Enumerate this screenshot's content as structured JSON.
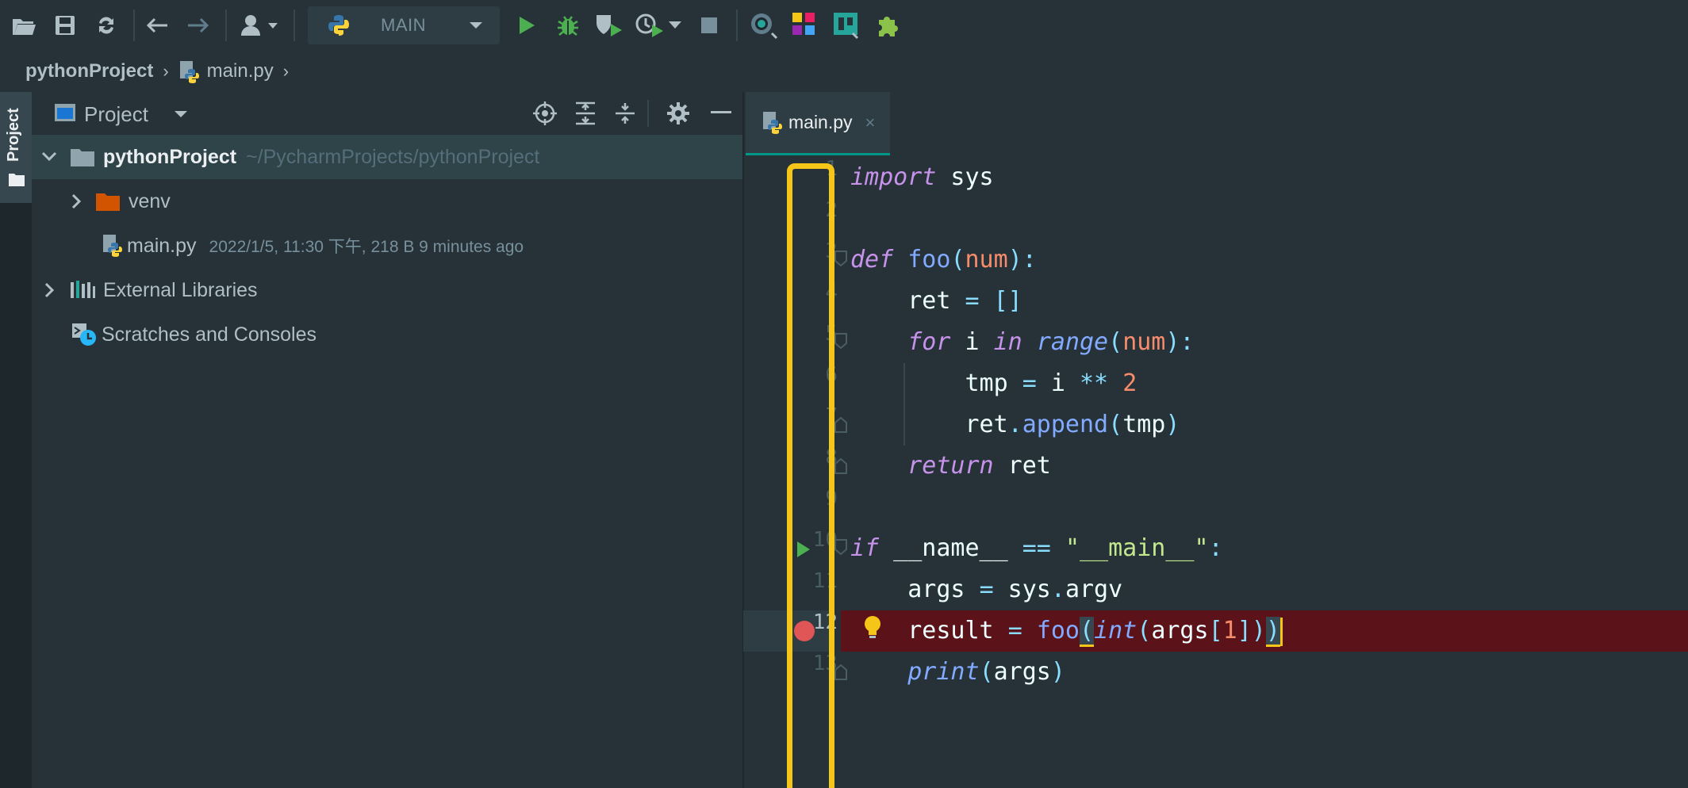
{
  "toolbar": {
    "run_config_label": "MAIN",
    "colors": {
      "run": "#4caf50",
      "debug": "#4caf50",
      "stop": "#78909c"
    }
  },
  "breadcrumb": {
    "project": "pythonProject",
    "file": "main.py"
  },
  "stripe": {
    "label": "Project"
  },
  "project_panel": {
    "title": "Project",
    "tree": [
      {
        "name": "pythonProject",
        "path": "~/PycharmProjects/pythonProject"
      },
      {
        "name": "venv"
      },
      {
        "name": "main.py",
        "meta": "2022/1/5, 11:30 下午, 218 B 9 minutes ago"
      },
      {
        "name": "External Libraries"
      },
      {
        "name": "Scratches and Consoles"
      }
    ]
  },
  "editor": {
    "tab": {
      "label": "main.py",
      "close": "×"
    },
    "line_numbers": [
      "1",
      "2",
      "3",
      "4",
      "5",
      "6",
      "7",
      "8",
      "9",
      "10",
      "11",
      "12",
      "13"
    ],
    "code": {
      "l1_kw": "import",
      "l1_rest": " sys",
      "l3_kw": "def",
      "l3_fn": "foo",
      "l3_p1": "(",
      "l3_param": "num",
      "l3_p2": "):",
      "l4_a": "    ret ",
      "l4_op": "=",
      "l4_b": " ",
      "l4_br": "[]",
      "l5_sp": "    ",
      "l5_kw": "for",
      "l5_a": " i ",
      "l5_kw2": "in",
      "l5_b": " ",
      "l5_fn": "range",
      "l5_p1": "(",
      "l5_param": "num",
      "l5_p2": "):",
      "l6_a": "        tmp ",
      "l6_op": "=",
      "l6_b": " i ",
      "l6_op2": "**",
      "l6_c": " ",
      "l6_num": "2",
      "l7_a": "        ret",
      "l7_dot": ".",
      "l7_fn": "append",
      "l7_p1": "(",
      "l7_b": "tmp",
      "l7_p2": ")",
      "l8_sp": "    ",
      "l8_kw": "return",
      "l8_rest": " ret",
      "l10_kw": "if",
      "l10_a": " __name__ ",
      "l10_op": "==",
      "l10_b": " ",
      "l10_str": "\"__main__\"",
      "l10_c": ":",
      "l11_a": "    args ",
      "l11_op": "=",
      "l11_b": " sys",
      "l11_dot": ".",
      "l11_c": "argv",
      "l12_a": "    result ",
      "l12_op": "=",
      "l12_b": " ",
      "l12_fn": "foo",
      "l12_p1": "(",
      "l12_bi": "int",
      "l12_p2": "(",
      "l12_c": "args",
      "l12_p3": "[",
      "l12_num": "1",
      "l12_p4": "])",
      "l12_p5": ")",
      "l13_sp": "    ",
      "l13_bi": "print",
      "l13_p1": "(",
      "l13_a": "args",
      "l13_p2": ")"
    },
    "colors": {
      "error_line_bg": "#5b1218",
      "breakpoint": "#e05555",
      "run_gutter": "#4caf50",
      "highlight_box": "#f5c518"
    }
  }
}
